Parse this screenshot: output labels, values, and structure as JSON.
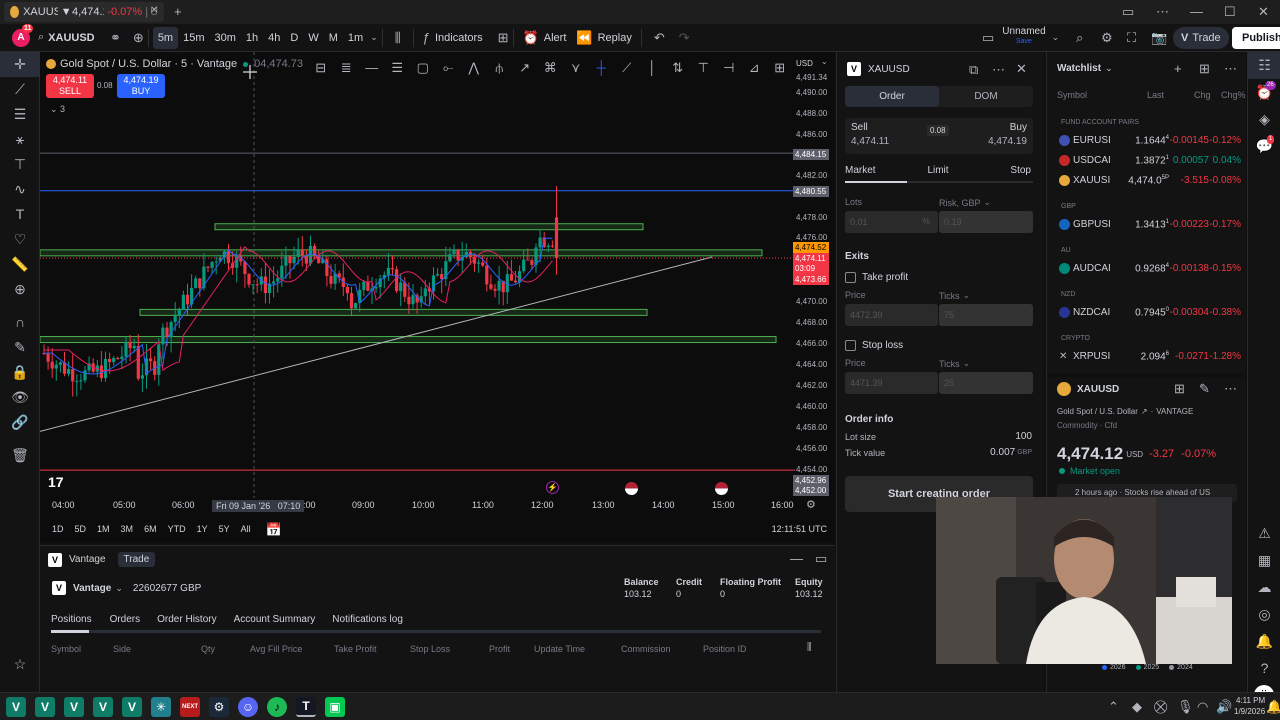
{
  "browser": {
    "tab_title": "XAUUSD",
    "tab_price": "4,474.12",
    "tab_change": "-0.07%",
    "tab_suffix": "U"
  },
  "toolbar": {
    "symbol": "XAUUSD",
    "avatar_badge": "11",
    "intervals": [
      "5m",
      "15m",
      "30m",
      "1h",
      "4h",
      "D",
      "W",
      "M",
      "1m"
    ],
    "indicators_label": "Indicators",
    "alert_label": "Alert",
    "replay_label": "Replay",
    "layout_name": "Unnamed",
    "layout_sub": "Save",
    "trade_label": "Trade",
    "publish_label": "Publish"
  },
  "chart": {
    "legend": "Gold Spot / U.S. Dollar · 5 · Vantage",
    "legend_value": "04,474.73",
    "sell_price": "4,474.11",
    "sell_label": "SELL",
    "buy_price": "4,474.19",
    "buy_label": "BUY",
    "spread": "0.08",
    "indicator_count": "3",
    "currency": "USD",
    "price_labels": [
      "4,491.34",
      "4,490.00",
      "4,488.00",
      "4,486.00",
      "4,482.00",
      "4,478.00",
      "4,476.00",
      "4,472.00",
      "4,470.00",
      "4,468.00",
      "4,466.00",
      "4,464.00",
      "4,462.00",
      "4,460.00",
      "4,458.00",
      "4,456.00",
      "4,454.00"
    ],
    "price_tags": {
      "t1": "4,484.15",
      "t2": "4,480.55",
      "t3": "4,474.52",
      "t4": "4,474.11",
      "t5": "03:09",
      "t6": "4,473.66",
      "t7": "4,452.96",
      "t8": "4,452.00"
    },
    "time_labels": [
      "04:00",
      "05:00",
      "06:00",
      "8:00",
      "09:00",
      "10:00",
      "11:00",
      "12:00",
      "13:00",
      "14:00",
      "15:00",
      "16:00"
    ],
    "crosshair_time": "Fri 09 Jan '26   07:10",
    "ranges": [
      "1D",
      "5D",
      "1M",
      "3M",
      "6M",
      "YTD",
      "1Y",
      "5Y",
      "All"
    ],
    "clock": "12:11:51 UTC"
  },
  "bottom": {
    "broker": "Vantage",
    "tab_trade": "Trade",
    "account": "Vantage",
    "account_id": "22602677 GBP",
    "balance_label": "Balance",
    "balance": "103.12",
    "credit_label": "Credit",
    "credit": "0",
    "floating_label": "Floating Profit",
    "floating": "0",
    "equity_label": "Equity",
    "equity": "103.12",
    "tabs": [
      "Positions",
      "Orders",
      "Order History",
      "Account Summary",
      "Notifications log"
    ],
    "columns": [
      "Symbol",
      "Side",
      "Qty",
      "Avg Fill Price",
      "Take Profit",
      "Stop Loss",
      "Profit",
      "Update Time",
      "Commission",
      "Position ID"
    ]
  },
  "order": {
    "symbol": "XAUUSD",
    "tab_order": "Order",
    "tab_dom": "DOM",
    "sell_label": "Sell",
    "sell_price": "4,474.11",
    "spread": "0.08",
    "buy_label": "Buy",
    "buy_price": "4,474.19",
    "types": [
      "Market",
      "Limit",
      "Stop"
    ],
    "lots_label": "Lots",
    "lots_value": "0.01",
    "risk_label": "Risk, GBP",
    "risk_value": "0.19",
    "exits_label": "Exits",
    "tp_label": "Take profit",
    "price_label": "Price",
    "ticks_label": "Ticks",
    "tp_price": "4472.39",
    "tp_ticks": "75",
    "sl_label": "Stop loss",
    "sl_price": "4471.39",
    "sl_ticks": "25",
    "info_label": "Order info",
    "lot_size_label": "Lot size",
    "lot_size": "100",
    "tick_value_label": "Tick value",
    "tick_value": "0.007",
    "tick_value_unit": "GBP",
    "start_label": "Start creating order"
  },
  "watchlist": {
    "title": "Watchlist",
    "col_symbol": "Symbol",
    "col_last": "Last",
    "col_chg": "Chg",
    "col_chgp": "Chg%",
    "sections": [
      "FUND ACCOUNT PAIRS",
      "GBP",
      "AU",
      "NZD",
      "CRYPTO"
    ],
    "rows": [
      {
        "symbol": "EURUSI",
        "last": "1.1644",
        "sup": "4",
        "chg": "-0.00145",
        "chgp": "-0.12%"
      },
      {
        "symbol": "USDCAI",
        "last": "1.3872",
        "sup": "1",
        "chg": "0.00057",
        "chgp": "0.04%"
      },
      {
        "symbol": "XAUUSI",
        "last": "4,474.0",
        "sup": "5P",
        "chg": "-3.515",
        "chgp": "-0.08%"
      },
      {
        "symbol": "GBPUSI",
        "last": "1.3413",
        "sup": "1",
        "chg": "-0.00223",
        "chgp": "-0.17%"
      },
      {
        "symbol": "AUDCAI",
        "last": "0.9268",
        "sup": "4",
        "chg": "-0.00138",
        "chgp": "-0.15%"
      },
      {
        "symbol": "NZDCAI",
        "last": "0.7945",
        "sup": "0",
        "chg": "-0.00304",
        "chgp": "-0.38%"
      },
      {
        "symbol": "XRPUSI",
        "last": "2.094",
        "sup": "6",
        "chg": "-0.0271",
        "chgp": "-1.28%"
      }
    ],
    "detail_symbol": "XAUUSD",
    "detail_name": "Gold Spot / U.S. Dollar",
    "detail_exchange": "VANTAGE",
    "detail_type": "Commodity · Cfd",
    "detail_price": "4,474.12",
    "detail_ccy": "USD",
    "detail_chg": "-3.27",
    "detail_chgp": "-0.07%",
    "detail_status": "Market open",
    "news": "2 hours ago · Stocks rise ahead of US",
    "years": [
      "2026",
      "2025",
      "2024"
    ],
    "rail_badges": [
      "26",
      "1"
    ]
  },
  "taskbar": {
    "time": "4:11 PM",
    "date": "1/9/2026"
  },
  "colors": {
    "up": "#089981",
    "down": "#f23645",
    "accent": "#2962ff",
    "zone": "#4caf50"
  }
}
